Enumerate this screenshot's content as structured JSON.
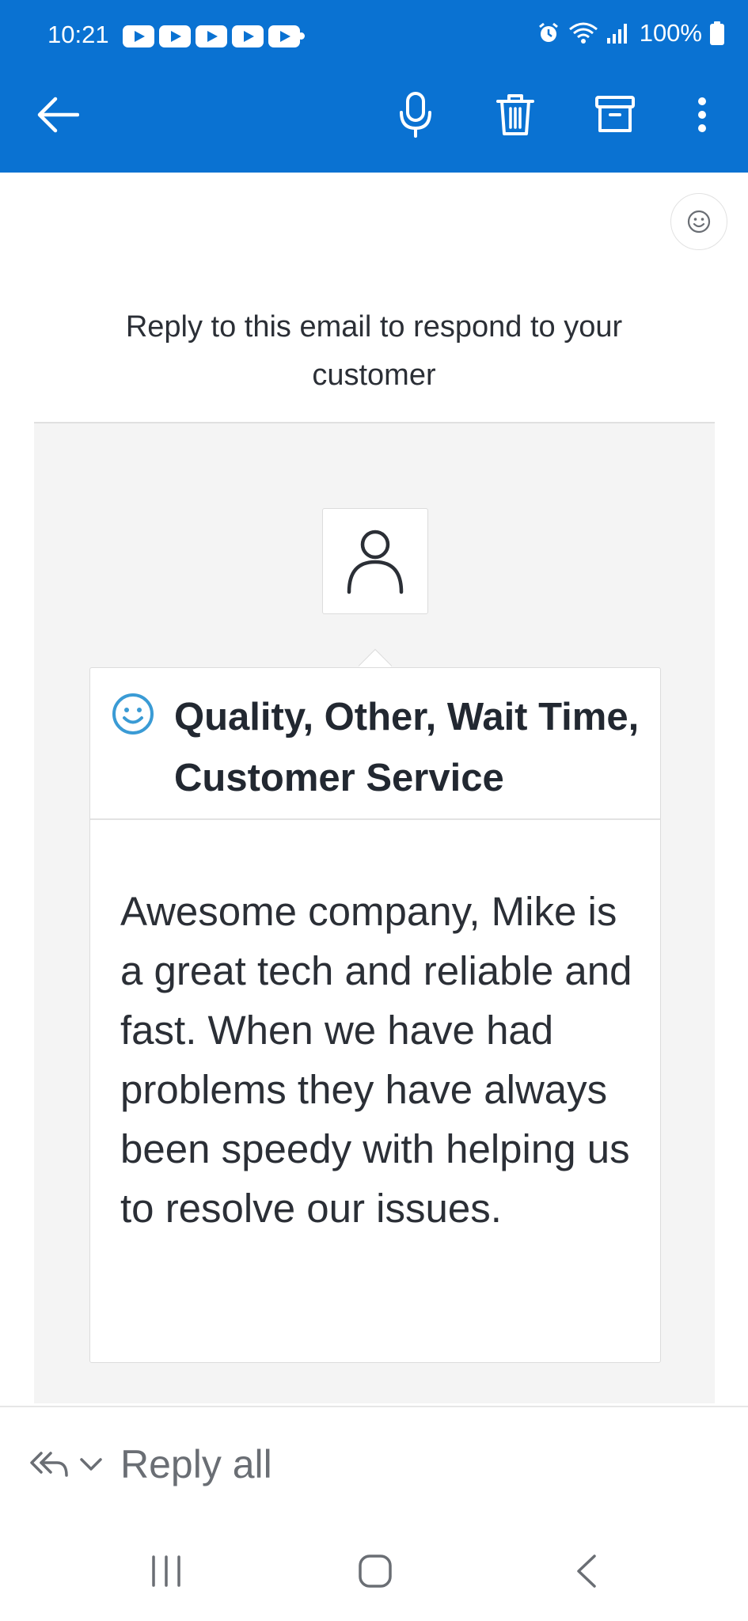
{
  "status_bar": {
    "time": "10:21",
    "battery": "100%",
    "notification_icons": [
      "youtube-icon",
      "youtube-icon",
      "youtube-icon",
      "youtube-icon",
      "youtube-icon"
    ]
  },
  "toolbar": {
    "icons": [
      "back-arrow-icon",
      "microphone-icon",
      "trash-icon",
      "archive-icon",
      "more-vert-icon"
    ],
    "color": "#0a72d2"
  },
  "email": {
    "reply_note": "Reply to this email to respond to your customer",
    "feedback": {
      "tags": "Quality, Other, Wait Time, Customer Service",
      "comment": "Awesome company, Mike is a great tech and reliable and fast. When we have had problems they have always been speedy with helping us to resolve our issues."
    }
  },
  "reply_bar": {
    "label": "Reply all"
  },
  "colors": {
    "brand_blue": "#0a72d2",
    "smiley_blue": "#3a9bd5",
    "panel_gray": "#f4f4f4"
  }
}
